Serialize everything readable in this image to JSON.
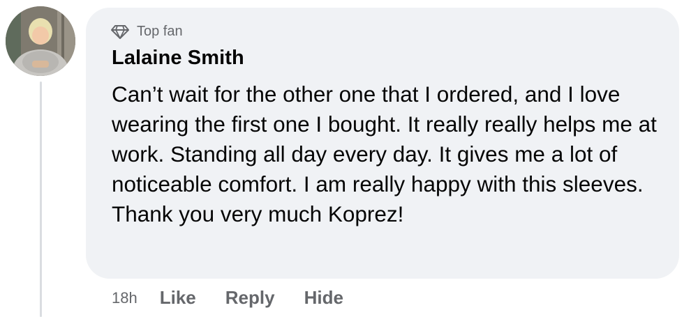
{
  "comment": {
    "badge_label": "Top fan",
    "author_name": "Lalaine Smith",
    "text": "Can’t wait for the other one that I ordered, and I love wearing the first one I bought. It really really helps me at work. Standing all day every day. It gives me a lot of noticeable comfort. I am really happy with this sleeves. Thank you very much Koprez!",
    "timestamp": "18h",
    "actions": {
      "like_label": "Like",
      "reply_label": "Reply",
      "hide_label": "Hide"
    }
  },
  "colors": {
    "bubble_bg": "#f0f2f5",
    "primary_text": "#050505",
    "secondary_text": "#65676b",
    "thread_line": "#dadde1"
  },
  "icons": {
    "badge_icon": "diamond-icon"
  }
}
